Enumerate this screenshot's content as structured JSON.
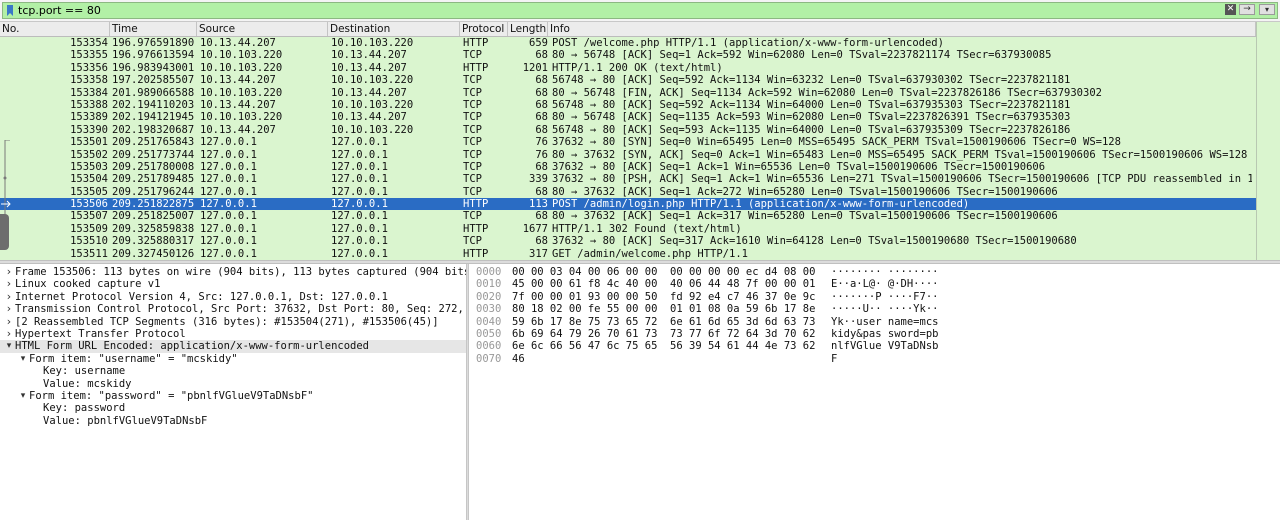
{
  "filter": {
    "value": "tcp.port == 80",
    "clear_icon": "clear-icon",
    "apply_icon": "arrow-right-icon",
    "dropdown_icon": "chevron-down-icon",
    "background_color": "#b2f0a6"
  },
  "packet_list": {
    "columns": [
      "No.",
      "Time",
      "Source",
      "Destination",
      "Protocol",
      "Length",
      "Info"
    ],
    "row_color": "#daf5cf",
    "selected_color": "#2a6cc4",
    "rows": [
      {
        "no": "153354",
        "time": "196.976591890",
        "source": "10.13.44.207",
        "destination": "10.10.103.220",
        "protocol": "HTTP",
        "length": "659",
        "info": "POST /welcome.php HTTP/1.1  (application/x-www-form-urlencoded)"
      },
      {
        "no": "153355",
        "time": "196.976613594",
        "source": "10.10.103.220",
        "destination": "10.13.44.207",
        "protocol": "TCP",
        "length": "68",
        "info": "80 → 56748 [ACK] Seq=1 Ack=592 Win=62080 Len=0 TSval=2237821174 TSecr=637930085"
      },
      {
        "no": "153356",
        "time": "196.983943001",
        "source": "10.10.103.220",
        "destination": "10.13.44.207",
        "protocol": "HTTP",
        "length": "1201",
        "info": "HTTP/1.1 200 OK  (text/html)"
      },
      {
        "no": "153358",
        "time": "197.202585507",
        "source": "10.13.44.207",
        "destination": "10.10.103.220",
        "protocol": "TCP",
        "length": "68",
        "info": "56748 → 80 [ACK] Seq=592 Ack=1134 Win=63232 Len=0 TSval=637930302 TSecr=2237821181"
      },
      {
        "no": "153384",
        "time": "201.989066588",
        "source": "10.10.103.220",
        "destination": "10.13.44.207",
        "protocol": "TCP",
        "length": "68",
        "info": "80 → 56748 [FIN, ACK] Seq=1134 Ack=592 Win=62080 Len=0 TSval=2237826186 TSecr=637930302"
      },
      {
        "no": "153388",
        "time": "202.194110203",
        "source": "10.13.44.207",
        "destination": "10.10.103.220",
        "protocol": "TCP",
        "length": "68",
        "info": "56748 → 80 [ACK] Seq=592 Ack=1134 Win=64000 Len=0 TSval=637935303 TSecr=2237821181"
      },
      {
        "no": "153389",
        "time": "202.194121945",
        "source": "10.10.103.220",
        "destination": "10.13.44.207",
        "protocol": "TCP",
        "length": "68",
        "info": "80 → 56748 [ACK] Seq=1135 Ack=593 Win=62080 Len=0 TSval=2237826391 TSecr=637935303"
      },
      {
        "no": "153390",
        "time": "202.198320687",
        "source": "10.13.44.207",
        "destination": "10.10.103.220",
        "protocol": "TCP",
        "length": "68",
        "info": "56748 → 80 [ACK] Seq=593 Ack=1135 Win=64000 Len=0 TSval=637935309 TSecr=2237826186"
      },
      {
        "no": "153501",
        "time": "209.251765843",
        "source": "127.0.0.1",
        "destination": "127.0.0.1",
        "protocol": "TCP",
        "length": "76",
        "info": "37632 → 80 [SYN] Seq=0 Win=65495 Len=0 MSS=65495 SACK_PERM TSval=1500190606 TSecr=0 WS=128"
      },
      {
        "no": "153502",
        "time": "209.251773744",
        "source": "127.0.0.1",
        "destination": "127.0.0.1",
        "protocol": "TCP",
        "length": "76",
        "info": "80 → 37632 [SYN, ACK] Seq=0 Ack=1 Win=65483 Len=0 MSS=65495 SACK_PERM TSval=1500190606 TSecr=1500190606 WS=128"
      },
      {
        "no": "153503",
        "time": "209.251780008",
        "source": "127.0.0.1",
        "destination": "127.0.0.1",
        "protocol": "TCP",
        "length": "68",
        "info": "37632 → 80 [ACK] Seq=1 Ack=1 Win=65536 Len=0 TSval=1500190606 TSecr=1500190606"
      },
      {
        "no": "153504",
        "time": "209.251789485",
        "source": "127.0.0.1",
        "destination": "127.0.0.1",
        "protocol": "TCP",
        "length": "339",
        "info": "37632 → 80 [PSH, ACK] Seq=1 Ack=1 Win=65536 Len=271 TSval=1500190606 TSecr=1500190606 [TCP PDU reassembled in 1…"
      },
      {
        "no": "153505",
        "time": "209.251796244",
        "source": "127.0.0.1",
        "destination": "127.0.0.1",
        "protocol": "TCP",
        "length": "68",
        "info": "80 → 37632 [ACK] Seq=1 Ack=272 Win=65280 Len=0 TSval=1500190606 TSecr=1500190606"
      },
      {
        "no": "153506",
        "time": "209.251822875",
        "source": "127.0.0.1",
        "destination": "127.0.0.1",
        "protocol": "HTTP",
        "length": "113",
        "info": "POST /admin/login.php HTTP/1.1  (application/x-www-form-urlencoded)",
        "selected": true
      },
      {
        "no": "153507",
        "time": "209.251825007",
        "source": "127.0.0.1",
        "destination": "127.0.0.1",
        "protocol": "TCP",
        "length": "68",
        "info": "80 → 37632 [ACK] Seq=1 Ack=317 Win=65280 Len=0 TSval=1500190606 TSecr=1500190606"
      },
      {
        "no": "153509",
        "time": "209.325859838",
        "source": "127.0.0.1",
        "destination": "127.0.0.1",
        "protocol": "HTTP",
        "length": "1677",
        "info": "HTTP/1.1 302 Found  (text/html)"
      },
      {
        "no": "153510",
        "time": "209.325880317",
        "source": "127.0.0.1",
        "destination": "127.0.0.1",
        "protocol": "TCP",
        "length": "68",
        "info": "37632 → 80 [ACK] Seq=317 Ack=1610 Win=64128 Len=0 TSval=1500190680 TSecr=1500190680"
      },
      {
        "no": "153511",
        "time": "209.327450126",
        "source": "127.0.0.1",
        "destination": "127.0.0.1",
        "protocol": "HTTP",
        "length": "317",
        "info": "GET /admin/welcome.php HTTP/1.1"
      }
    ]
  },
  "details": {
    "rows": [
      {
        "level": 0,
        "expander": "collapsed",
        "text": "Frame 153506: 113 bytes on wire (904 bits), 113 bytes captured (904 bits"
      },
      {
        "level": 0,
        "expander": "collapsed",
        "text": "Linux cooked capture v1"
      },
      {
        "level": 0,
        "expander": "collapsed",
        "text": "Internet Protocol Version 4, Src: 127.0.0.1, Dst: 127.0.0.1"
      },
      {
        "level": 0,
        "expander": "collapsed",
        "text": "Transmission Control Protocol, Src Port: 37632, Dst Port: 80, Seq: 272, A"
      },
      {
        "level": 0,
        "expander": "collapsed",
        "text": "[2 Reassembled TCP Segments (316 bytes): #153504(271), #153506(45)]"
      },
      {
        "level": 0,
        "expander": "collapsed",
        "text": "Hypertext Transfer Protocol"
      },
      {
        "level": 0,
        "expander": "expanded",
        "text": "HTML Form URL Encoded: application/x-www-form-urlencoded",
        "selected": true
      },
      {
        "level": 1,
        "expander": "expanded",
        "text": "Form item: \"username\" = \"mcskidy\""
      },
      {
        "level": 2,
        "expander": "none",
        "text": "Key: username"
      },
      {
        "level": 2,
        "expander": "none",
        "text": "Value: mcskidy"
      },
      {
        "level": 1,
        "expander": "expanded",
        "text": "Form item: \"password\" = \"pbnlfVGlueV9TaDNsbF\""
      },
      {
        "level": 2,
        "expander": "none",
        "text": "Key: password"
      },
      {
        "level": 2,
        "expander": "none",
        "text": "Value: pbnlfVGlueV9TaDNsbF"
      }
    ]
  },
  "bytes": {
    "rows": [
      {
        "offset": "0000",
        "hex": "00 00 03 04 00 06 00 00  00 00 00 00 ec d4 08 00",
        "ascii": "········ ········"
      },
      {
        "offset": "0010",
        "hex": "45 00 00 61 f8 4c 40 00  40 06 44 48 7f 00 00 01",
        "ascii": "E··a·L@· @·DH····"
      },
      {
        "offset": "0020",
        "hex": "7f 00 00 01 93 00 00 50  fd 92 e4 c7 46 37 0e 9c",
        "ascii": "·······P ····F7··"
      },
      {
        "offset": "0030",
        "hex": "80 18 02 00 fe 55 00 00  01 01 08 0a 59 6b 17 8e",
        "ascii": "·····U·· ····Yk··"
      },
      {
        "offset": "0040",
        "hex": "59 6b 17 8e 75 73 65 72  6e 61 6d 65 3d 6d 63 73",
        "ascii": "Yk··user name=mcs"
      },
      {
        "offset": "0050",
        "hex": "6b 69 64 79 26 70 61 73  73 77 6f 72 64 3d 70 62",
        "ascii": "kidy&pas sword=pb"
      },
      {
        "offset": "0060",
        "hex": "6e 6c 66 56 47 6c 75 65  56 39 54 61 44 4e 73 62",
        "ascii": "nlfVGlue V9TaDNsb"
      },
      {
        "offset": "0070",
        "hex": "46",
        "ascii": "F"
      }
    ]
  }
}
